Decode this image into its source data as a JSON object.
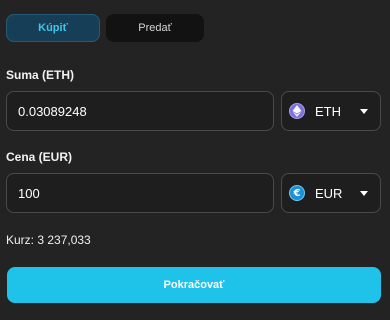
{
  "tabs": {
    "buy_label": "Kúpiť",
    "sell_label": "Predať",
    "active": "buy"
  },
  "amount": {
    "label": "Suma (ETH)",
    "value": "0.03089248",
    "currency": "ETH",
    "currency_icon": "ethereum-icon"
  },
  "price": {
    "label": "Cena (EUR)",
    "value": "100",
    "currency": "EUR",
    "currency_icon": "euro-icon",
    "currency_symbol": "€"
  },
  "rate": {
    "text": "Kurz: 3 237,033"
  },
  "continue_button": {
    "label": "Pokračovať"
  },
  "colors": {
    "accent": "#1fc2e8",
    "active_tab_bg": "#173e57",
    "active_tab_text": "#3fc6e6",
    "background": "#232323",
    "field_border": "#4a4a4a"
  }
}
